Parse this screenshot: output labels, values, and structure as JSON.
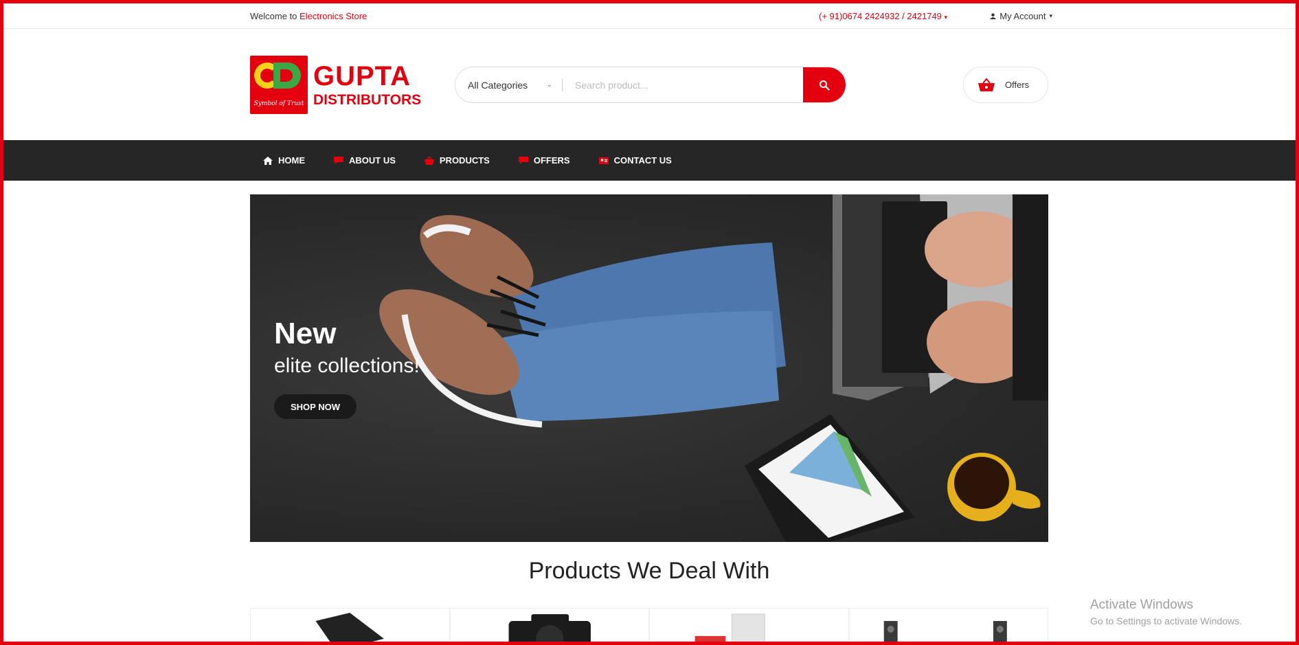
{
  "topbar": {
    "welcome_prefix": "Welcome to ",
    "store_name": "Electronics Store",
    "phone": "(+ 91)0674 2424932 / 2421749",
    "account_label": "My Account"
  },
  "logo": {
    "line1": "GUPTA",
    "line2": "DISTRIBUTORS",
    "tagline": "Symbol of Trust"
  },
  "search": {
    "category": "All Categories",
    "placeholder": "Search product..."
  },
  "header": {
    "offers_label": "Offers"
  },
  "nav": {
    "items": [
      {
        "label": "HOME",
        "icon": "home-icon"
      },
      {
        "label": "ABOUT US",
        "icon": "chat-bubble-icon"
      },
      {
        "label": "PRODUCTS",
        "icon": "basket-icon"
      },
      {
        "label": "OFFERS",
        "icon": "chat-bubble-icon"
      },
      {
        "label": "CONTACT US",
        "icon": "contact-card-icon"
      }
    ]
  },
  "hero": {
    "title": "New",
    "subtitle": "elite collections!",
    "cta": "SHOP NOW"
  },
  "products": {
    "heading": "Products We Deal With"
  },
  "watermark": {
    "line1": "Activate Windows",
    "line2": "Go to Settings to activate Windows."
  },
  "colors": {
    "accent": "#e3000f",
    "nav_bg": "#262626"
  }
}
